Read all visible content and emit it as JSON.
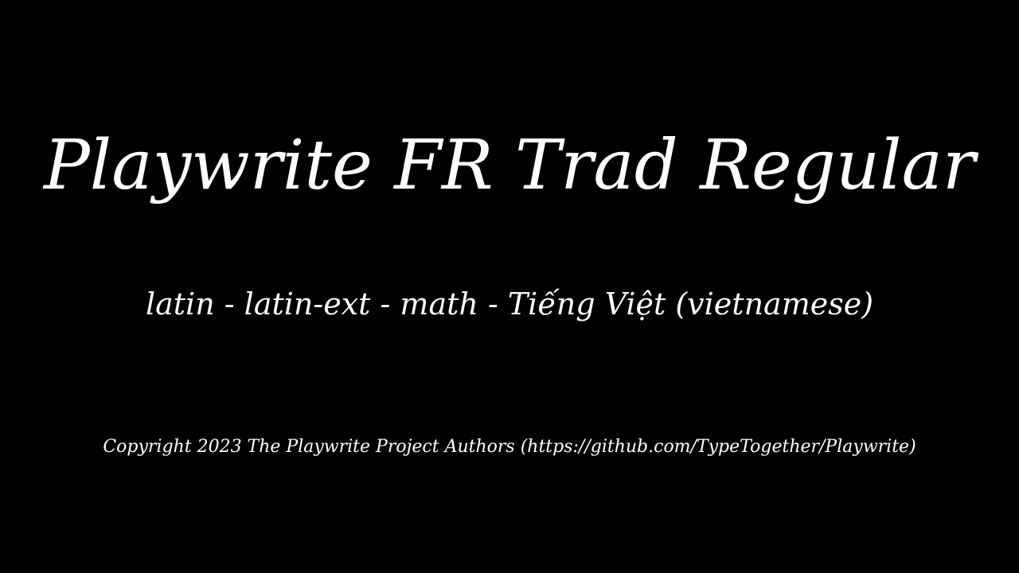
{
  "page": {
    "background": "#000000",
    "foreground": "#ffffff"
  },
  "specimen": {
    "title": "Playwrite FR Trad Regular",
    "subsets": "latin - latin-ext - math - Tiếng Việt (vietnamese)",
    "copyright": "Copyright 2023 The Playwrite Project Authors (https://github.com/TypeTogether/Playwrite)"
  }
}
